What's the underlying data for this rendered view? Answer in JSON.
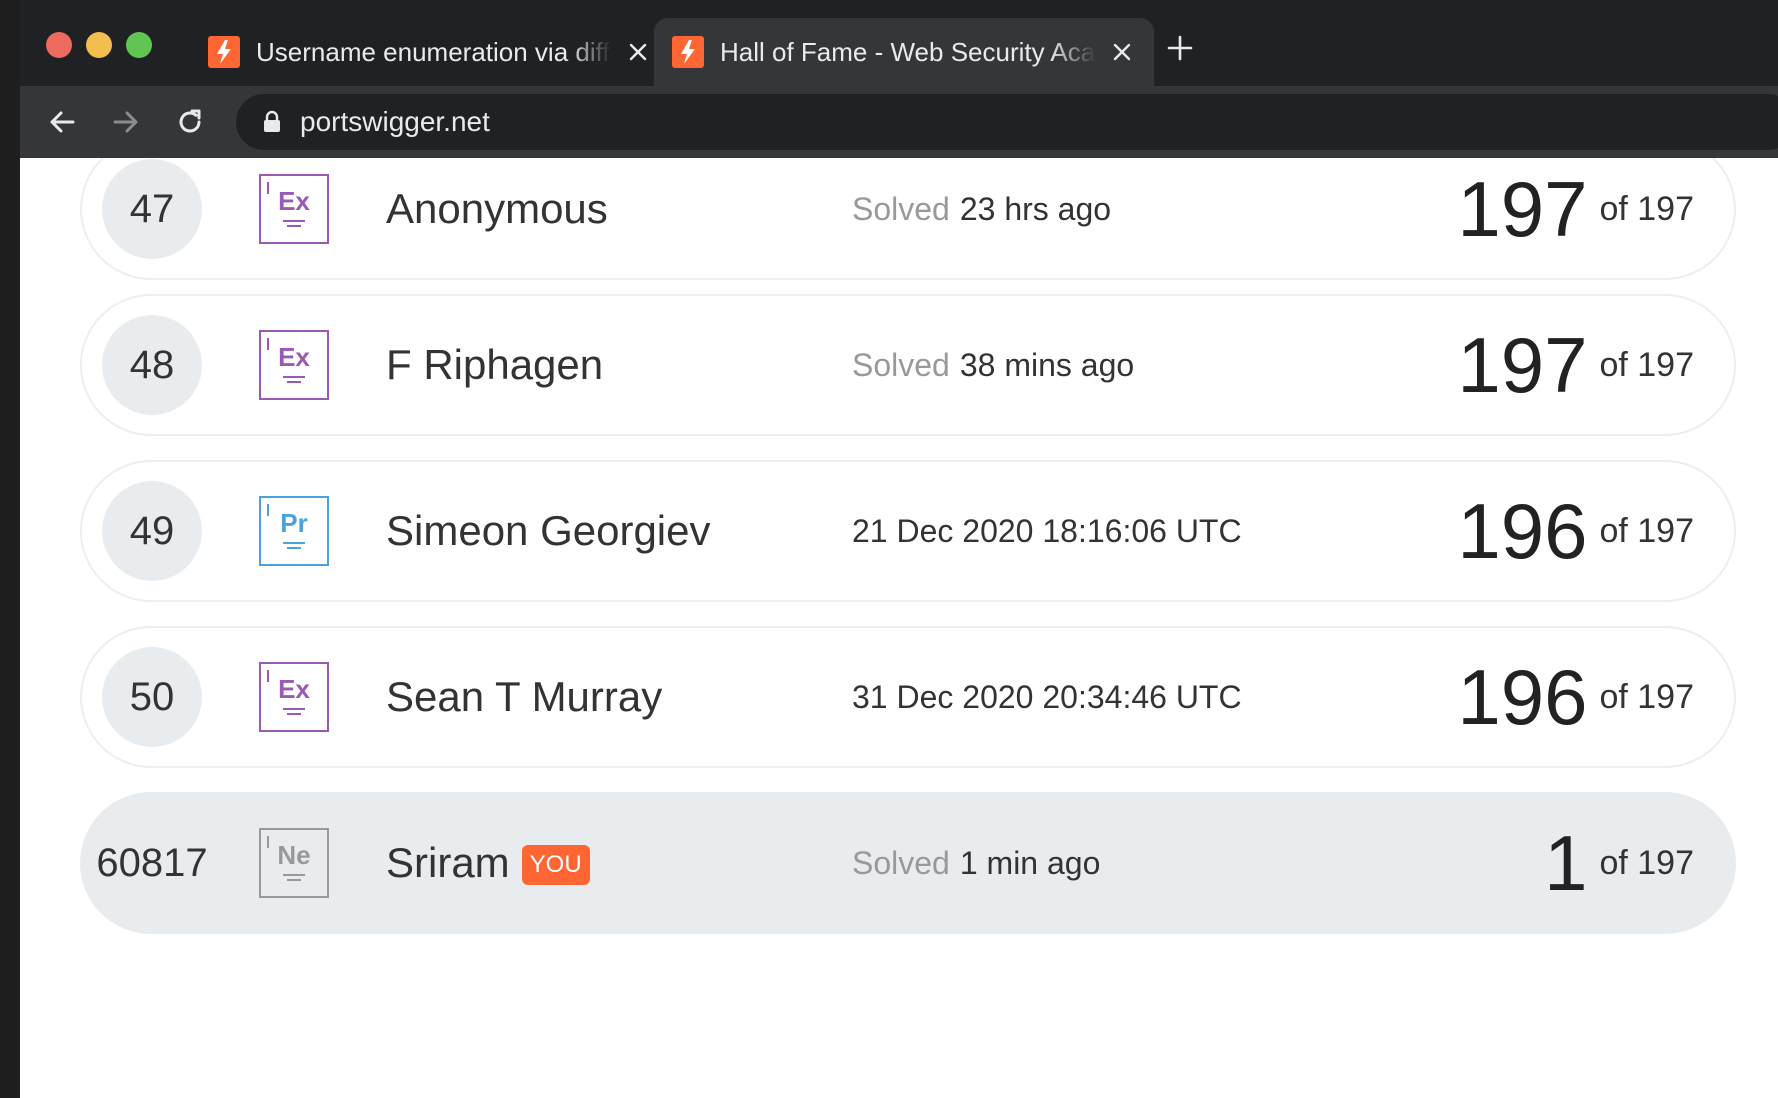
{
  "browser": {
    "tabs": [
      {
        "title": "Username enumeration via different responses",
        "active": false
      },
      {
        "title": "Hall of Fame - Web Security Academy",
        "active": true
      }
    ],
    "url": "portswigger.net"
  },
  "colors": {
    "expert": "#9b59b6",
    "practitioner": "#4aa3df",
    "newcomer": "#999999",
    "accent": "#ff6633"
  },
  "leaderboard": {
    "rows": [
      {
        "rank": "47",
        "badge": "Ex",
        "level": "expert",
        "name": "Anonymous",
        "solved_prefix": "Solved",
        "solved": "23 hrs ago",
        "score": "197",
        "total": "of 197"
      },
      {
        "rank": "48",
        "badge": "Ex",
        "level": "expert",
        "name": "F Riphagen",
        "solved_prefix": "Solved",
        "solved": "38 mins ago",
        "score": "197",
        "total": "of 197"
      },
      {
        "rank": "49",
        "badge": "Pr",
        "level": "practitioner",
        "name": "Simeon Georgiev",
        "solved_prefix": "",
        "solved": "21 Dec 2020 18:16:06 UTC",
        "score": "196",
        "total": "of 197"
      },
      {
        "rank": "50",
        "badge": "Ex",
        "level": "expert",
        "name": "Sean T Murray",
        "solved_prefix": "",
        "solved": "31 Dec 2020 20:34:46 UTC",
        "score": "196",
        "total": "of 197"
      },
      {
        "rank": "60817",
        "badge": "Ne",
        "level": "newcomer",
        "name": "Sriram",
        "you_label": "YOU",
        "solved_prefix": "Solved",
        "solved": "1 min ago",
        "score": "1",
        "total": "of 197"
      }
    ]
  }
}
